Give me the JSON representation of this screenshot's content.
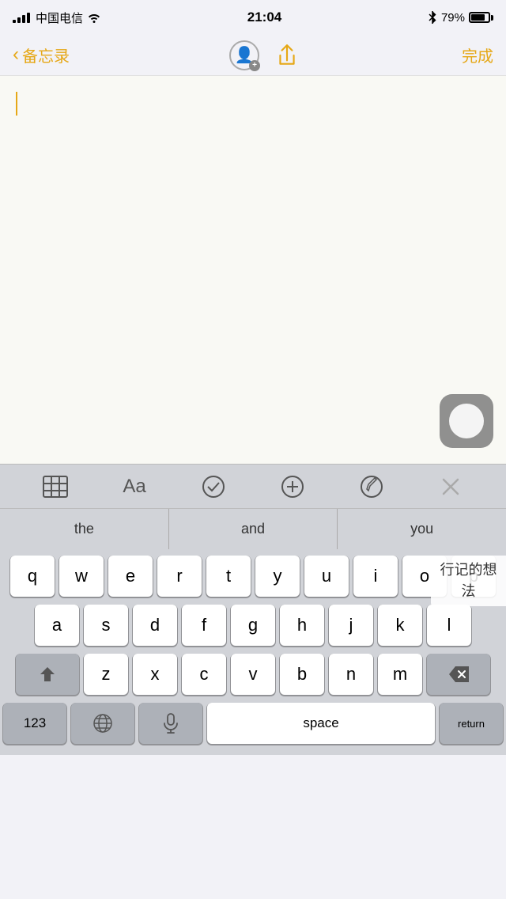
{
  "statusBar": {
    "carrier": "中国电信",
    "time": "21:04",
    "battery": "79%"
  },
  "navBar": {
    "backLabel": "备忘录",
    "doneLabel": "完成"
  },
  "toolbar": {
    "tableIcon": "table-icon",
    "fontIcon": "font-icon",
    "fontLabel": "Aa",
    "checkIcon": "check-icon",
    "addIcon": "add-icon",
    "penIcon": "pen-icon",
    "closeIcon": "close-icon"
  },
  "predictive": {
    "items": [
      "the",
      "and",
      "you"
    ]
  },
  "keyboard": {
    "row1": [
      "q",
      "w",
      "e",
      "r",
      "t",
      "y",
      "u",
      "i",
      "o",
      "p"
    ],
    "row2": [
      "a",
      "s",
      "d",
      "f",
      "g",
      "h",
      "j",
      "k",
      "l"
    ],
    "row3": [
      "z",
      "x",
      "c",
      "v",
      "b",
      "n",
      "m"
    ],
    "spaceLabel": "space",
    "numberLabel": "123",
    "deleteLabel": "⌫"
  },
  "popup": {
    "text": "行记的想法"
  }
}
